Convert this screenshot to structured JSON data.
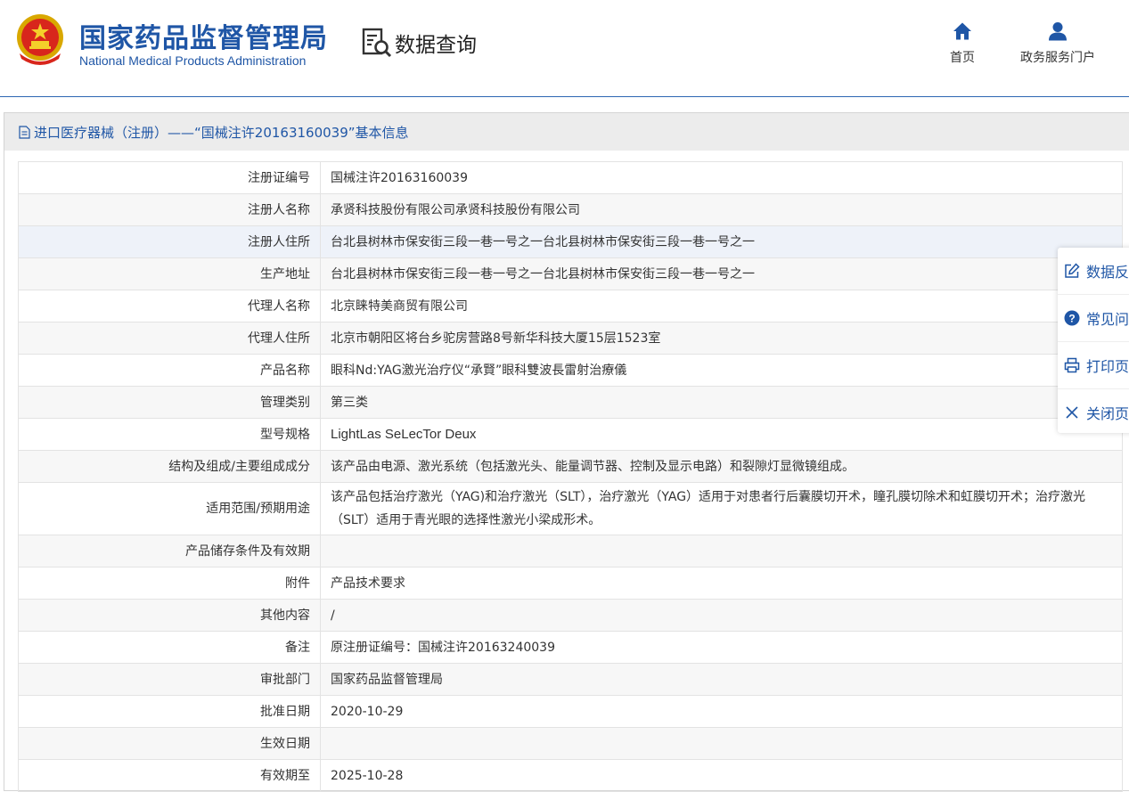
{
  "header": {
    "site_name_cn": "国家药品监督管理局",
    "site_name_en": "National Medical Products Administration",
    "data_query_label": "数据查询",
    "nav": [
      {
        "label": "首页",
        "icon": "home-icon"
      },
      {
        "label": "政务服务门户",
        "icon": "user-icon"
      }
    ]
  },
  "panel": {
    "title": "进口医疗器械（注册）——“国械注许20163160039”基本信息"
  },
  "details": [
    {
      "label": "注册证编号",
      "value": "国械注许20163160039"
    },
    {
      "label": "注册人名称",
      "value": "承贤科技股份有限公司承贤科技股份有限公司"
    },
    {
      "label": "注册人住所",
      "value": "台北县树林市保安街三段一巷一号之一台北县树林市保安街三段一巷一号之一"
    },
    {
      "label": "生产地址",
      "value": "台北县树林市保安街三段一巷一号之一台北县树林市保安街三段一巷一号之一"
    },
    {
      "label": "代理人名称",
      "value": "北京睐特美商贸有限公司"
    },
    {
      "label": "代理人住所",
      "value": "北京市朝阳区将台乡驼房营路8号新华科技大厦15层1523室"
    },
    {
      "label": "产品名称",
      "value": "眼科Nd:YAG激光治疗仪“承賢”眼科雙波長雷射治療儀"
    },
    {
      "label": "管理类别",
      "value": "第三类"
    },
    {
      "label": "型号规格",
      "value": "LightLas SeLecTor Deux"
    },
    {
      "label": "结构及组成/主要组成成分",
      "value": "该产品由电源、激光系统（包括激光头、能量调节器、控制及显示电路）和裂隙灯显微镜组成。"
    },
    {
      "label": "适用范围/预期用途",
      "value": "该产品包括治疗激光（YAG)和治疗激光（SLT），治疗激光（YAG）适用于对患者行后囊膜切开术，瞳孔膜切除术和虹膜切开术；治疗激光（SLT）适用于青光眼的选择性激光小梁成形术。"
    },
    {
      "label": "产品储存条件及有效期",
      "value": ""
    },
    {
      "label": "附件",
      "value": "产品技术要求"
    },
    {
      "label": "其他内容",
      "value": "/"
    },
    {
      "label": "备注",
      "value": "原注册证编号：国械注许20163240039"
    },
    {
      "label": "审批部门",
      "value": "国家药品监督管理局"
    },
    {
      "label": "批准日期",
      "value": "2020-10-29"
    },
    {
      "label": "生效日期",
      "value": ""
    },
    {
      "label": "有效期至",
      "value": "2025-10-28"
    }
  ],
  "side_panel": [
    {
      "label": "数据反",
      "icon": "edit-icon"
    },
    {
      "label": "常见问",
      "icon": "question-icon"
    },
    {
      "label": "打印页",
      "icon": "print-icon"
    },
    {
      "label": "关闭页",
      "icon": "close-icon"
    }
  ]
}
